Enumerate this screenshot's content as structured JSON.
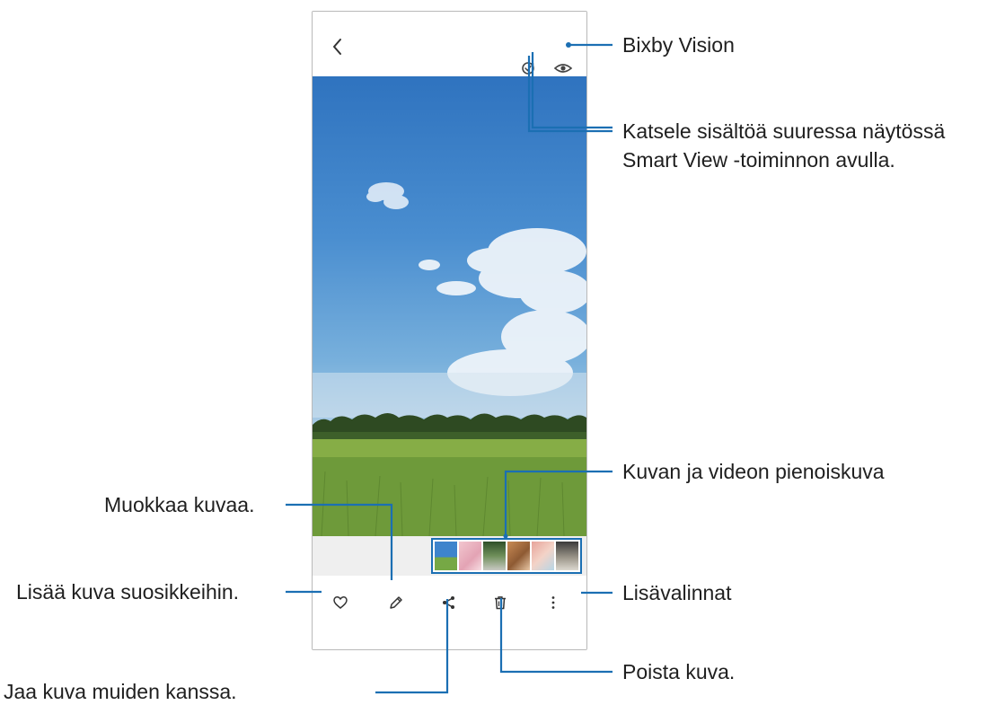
{
  "callouts": {
    "bixby_vision": "Bixby Vision",
    "smart_view_line1": "Katsele sisältöä suuressa näytössä",
    "smart_view_line2": "Smart View -toiminnon avulla.",
    "thumbnails": "Kuvan ja videon pienoiskuva",
    "edit": "Muokkaa kuvaa.",
    "favourite": "Lisää kuva suosikkeihin.",
    "more_options": "Lisävalinnat",
    "share": "Jaa kuva muiden kanssa.",
    "delete": "Poista kuva."
  },
  "icons": {
    "back": "chevron-left-icon",
    "smart_view": "cast-icon",
    "bixby_vision": "eye-icon",
    "favourite": "heart-icon",
    "edit": "pencil-icon",
    "share": "share-icon",
    "delete": "trash-icon",
    "more": "kebab-menu-icon"
  },
  "colors": {
    "callout_line": "#1b6fb3",
    "thumbnail_frame": "#1b6fb3",
    "sky": "#4a8ed0",
    "grass": "#6e9a3a"
  }
}
